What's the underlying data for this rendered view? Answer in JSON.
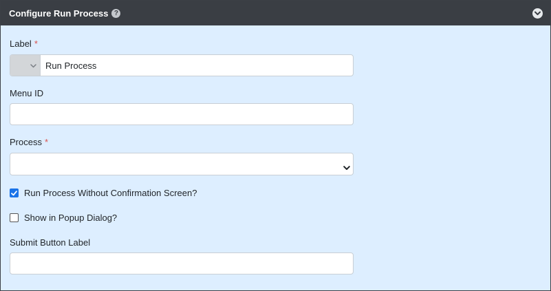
{
  "header": {
    "title": "Configure Run Process",
    "help_glyph": "?",
    "help_icon": "question-circle-icon",
    "collapse_icon": "chevron-down-circle-icon"
  },
  "form": {
    "label": {
      "title": "Label",
      "required_mark": "*",
      "value": "Run Process",
      "icon_picker_icon": "chevron-down-icon"
    },
    "menu_id": {
      "title": "Menu ID",
      "value": ""
    },
    "process": {
      "title": "Process",
      "required_mark": "*",
      "selected": ""
    },
    "run_without_confirmation": {
      "label": "Run Process Without Confirmation Screen?",
      "checked": true
    },
    "show_in_popup": {
      "label": "Show in Popup Dialog?",
      "checked": false
    },
    "submit_button_label": {
      "title": "Submit Button Label",
      "value": ""
    }
  },
  "colors": {
    "header_bg": "#3a3e44",
    "panel_bg": "#ddeeff",
    "required": "#d9534f",
    "checkbox_accent": "#1a73e8"
  }
}
